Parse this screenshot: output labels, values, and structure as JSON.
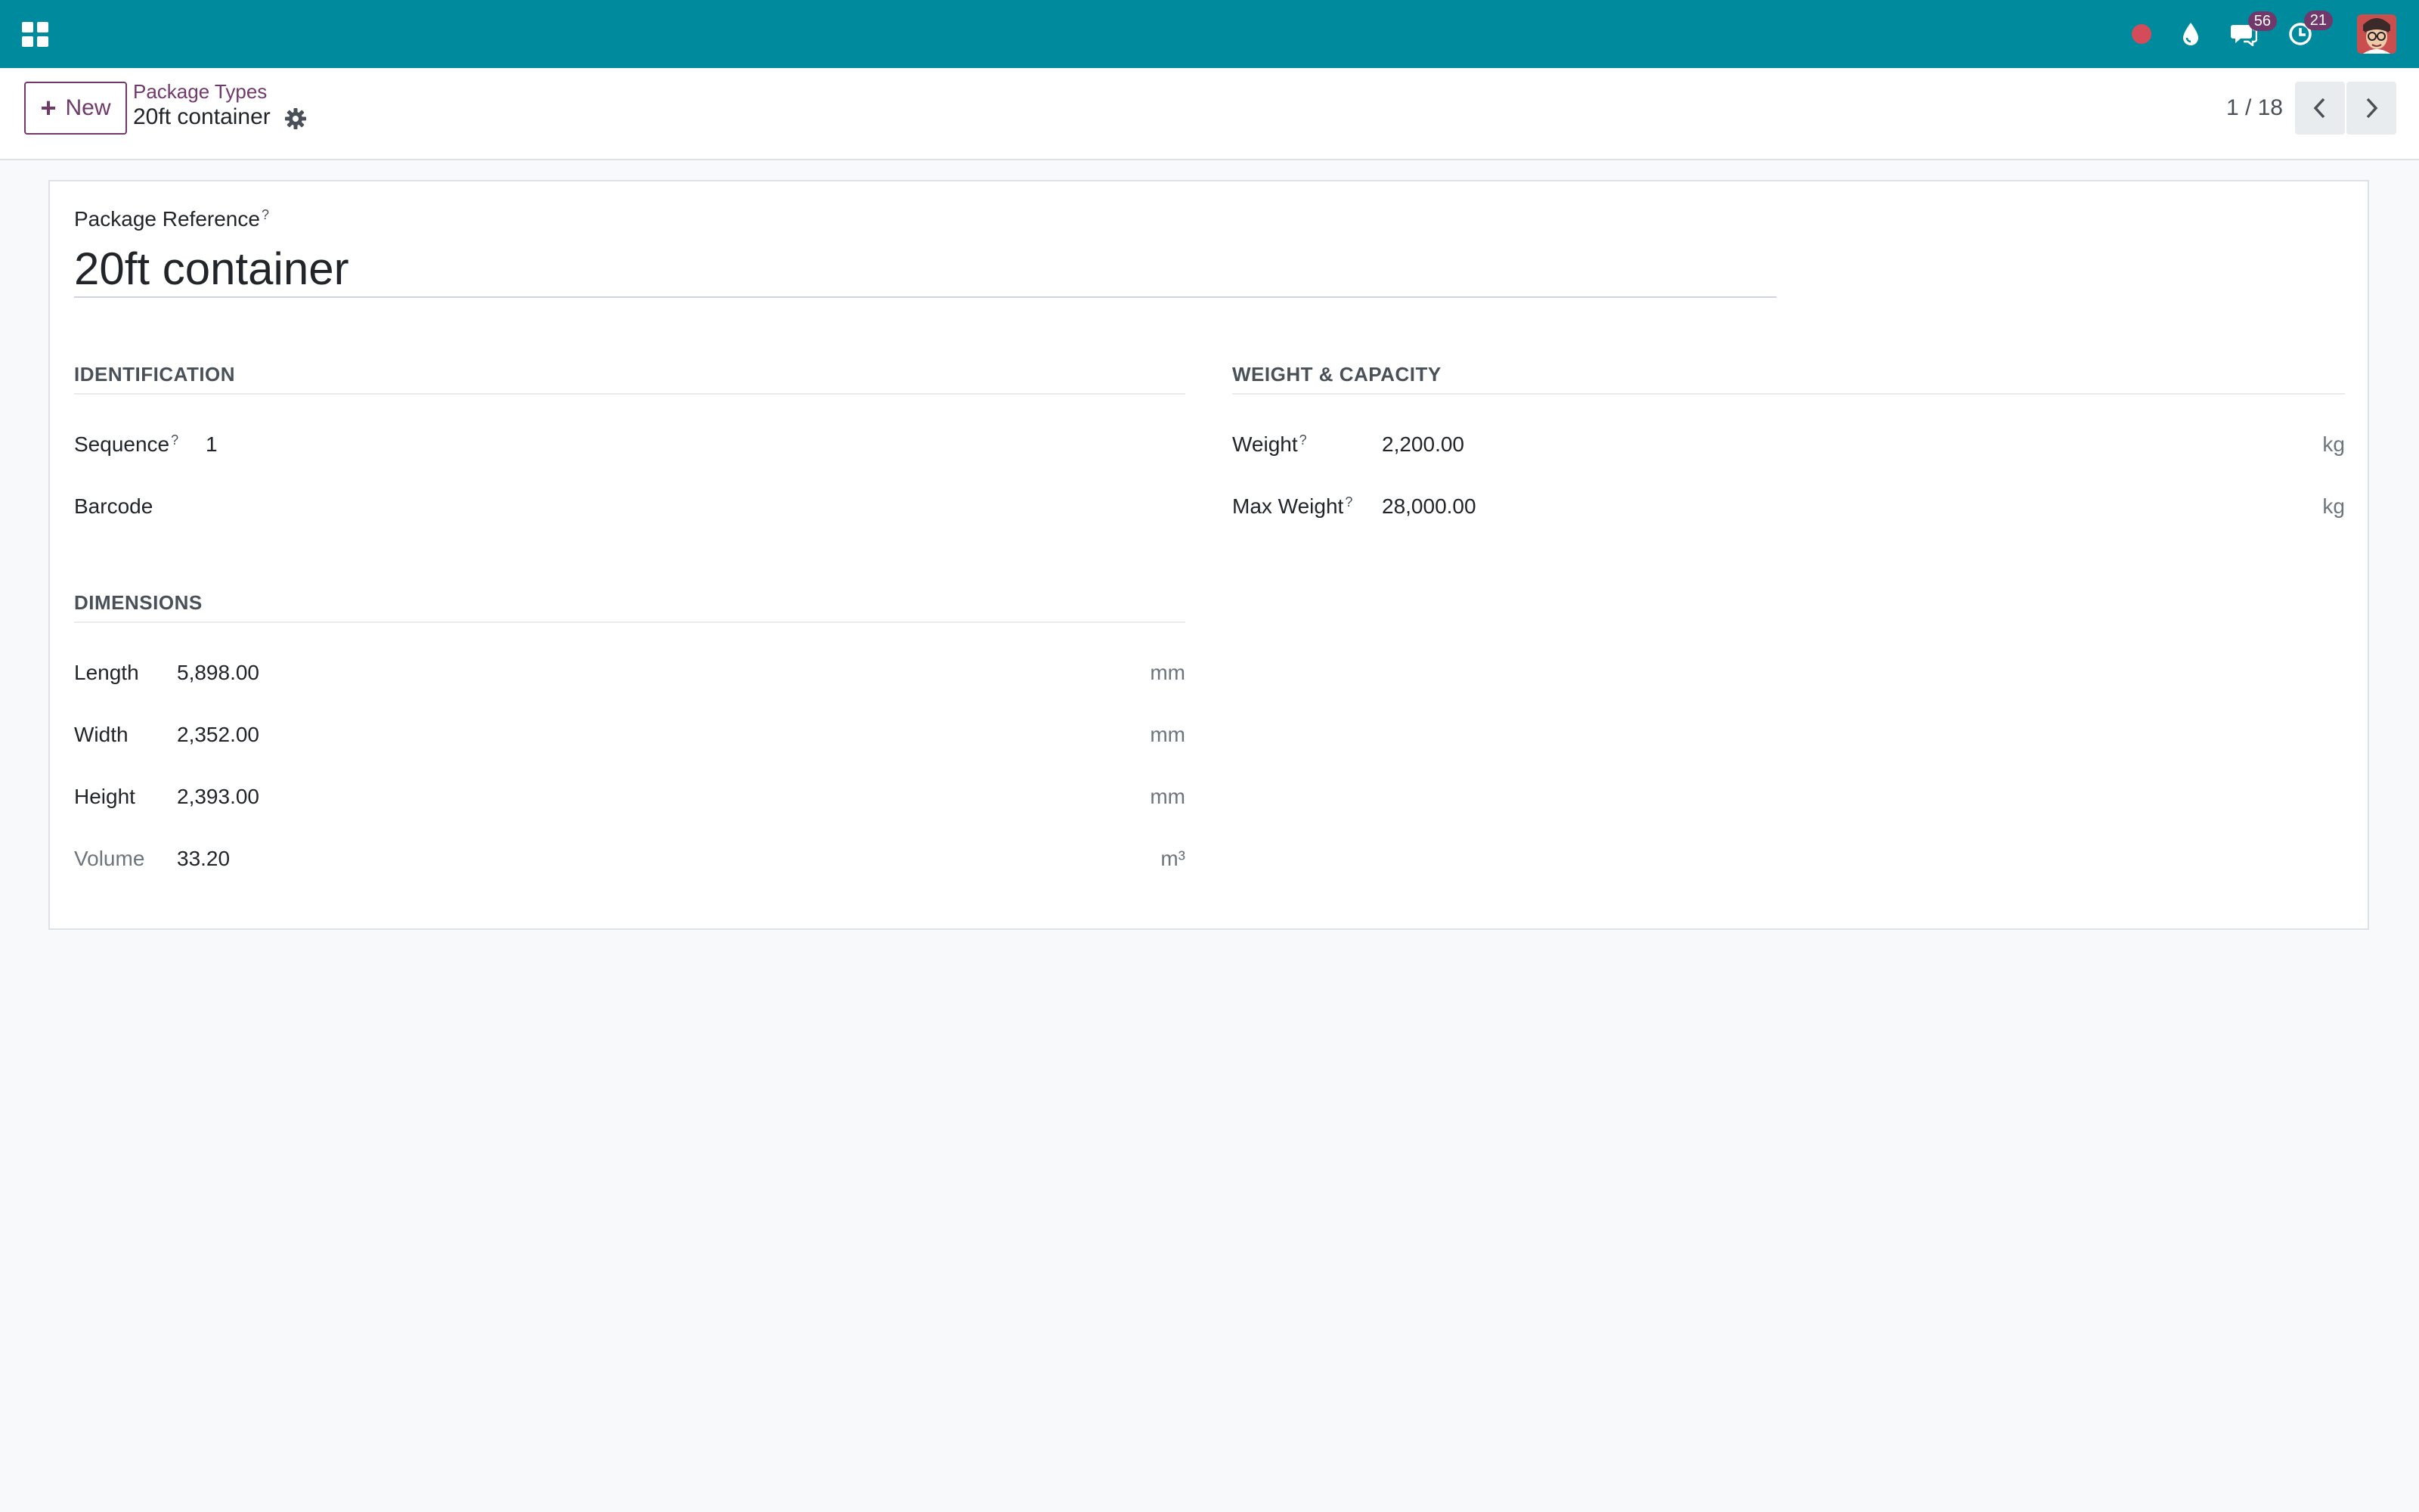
{
  "navbar": {
    "badges": {
      "messages": "56",
      "activities": "21"
    },
    "color": "#008a9e"
  },
  "control_panel": {
    "new_label": "New",
    "breadcrumb_parent": "Package Types",
    "breadcrumb_current": "20ft container",
    "pager_value": "1 / 18"
  },
  "form": {
    "name_label": "Package Reference",
    "help_mark": "?",
    "name_value": "20ft container",
    "identification": {
      "title": "Identification",
      "sequence_label": "Sequence",
      "sequence_value": "1",
      "barcode_label": "Barcode",
      "barcode_value": ""
    },
    "dimensions": {
      "title": "Dimensions",
      "rows": [
        {
          "label": "Length",
          "value": "5,898.00",
          "unit": "mm"
        },
        {
          "label": "Width",
          "value": "2,352.00",
          "unit": "mm"
        },
        {
          "label": "Height",
          "value": "2,393.00",
          "unit": "mm"
        },
        {
          "label": "Volume",
          "value": "33.20",
          "unit": "m³"
        }
      ]
    },
    "weight_capacity": {
      "title": "Weight & Capacity",
      "rows": [
        {
          "label": "Weight",
          "value": "2,200.00",
          "unit": "kg"
        },
        {
          "label": "Max Weight",
          "value": "28,000.00",
          "unit": "kg"
        }
      ]
    }
  },
  "colors": {
    "brand": "#71396b",
    "navbar": "#008a9e",
    "record_dot": "#d44c59"
  }
}
